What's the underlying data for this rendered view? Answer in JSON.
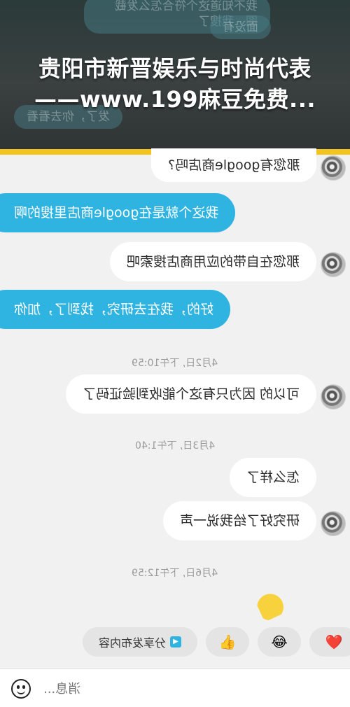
{
  "banner": {
    "line1": "贵阳市新晋娱乐与时尚代表",
    "line2": "——www.199麻豆免费...",
    "ghost_texts": [
      "我不知道这个符合怎么发截图，我搜了",
      "面没有",
      "发了，你去看看"
    ]
  },
  "messages": [
    {
      "side": "in",
      "text": "那您有google商店吗?"
    },
    {
      "side": "out",
      "text": "我这个就是在google商店里搜的啊"
    },
    {
      "side": "in",
      "text": "那您在自带的应用商店搜索吧"
    },
    {
      "side": "out",
      "text": "好的，我在去研究，找到了，加你"
    },
    {
      "side": "time",
      "text": "4月2日, 下午10:59"
    },
    {
      "side": "in",
      "text": "可以的 因为只有这个能收到验证码了"
    },
    {
      "side": "time",
      "text": "4月3日, 下午1:40"
    },
    {
      "side": "in",
      "text": "怎么样了"
    },
    {
      "side": "in",
      "text": "研究好了给我说一声"
    },
    {
      "side": "time",
      "text": "4月6日, 下午12:59"
    }
  ],
  "quick_replies": {
    "share": "分享发布内容",
    "thumbs": "👍",
    "laugh": "😂",
    "heart": "❤️"
  },
  "input": {
    "placeholder": "消息..."
  },
  "icons": {
    "emoji": "smiley-icon",
    "share": "share-play-icon"
  },
  "colors": {
    "outgoing_bubble": "#2fb3e0",
    "incoming_bubble": "#ffffff",
    "banner_strip": "#f3c51c"
  }
}
